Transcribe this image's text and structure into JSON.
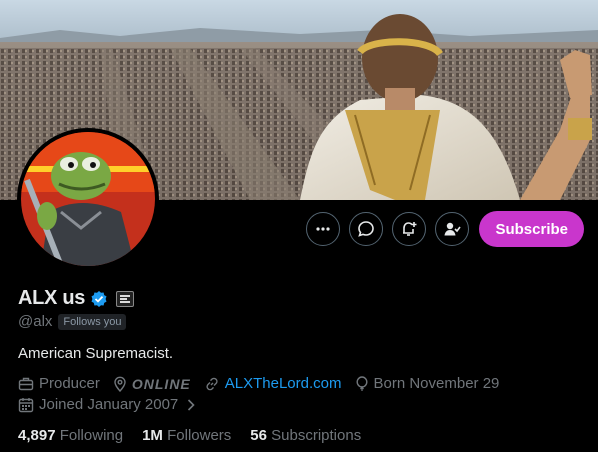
{
  "profile": {
    "display_name": "ALX us",
    "handle": "@alx",
    "follows_you": "Follows you",
    "bio": "American Supremacist.",
    "profession": "Producer",
    "location": "ONLINE",
    "website": "ALXTheLord.com",
    "birthday": "Born November 29",
    "joined": "Joined January 2007"
  },
  "stats": {
    "following_count": "4,897",
    "following_label": "Following",
    "followers_count": "1M",
    "followers_label": "Followers",
    "subscriptions_count": "56",
    "subscriptions_label": "Subscriptions"
  },
  "actions": {
    "subscribe_label": "Subscribe"
  },
  "icons": [
    "more-icon",
    "message-icon",
    "notify-icon",
    "following-icon",
    "verified-icon",
    "briefcase-icon",
    "location-icon",
    "link-icon",
    "balloon-icon",
    "calendar-icon",
    "chevron-right-icon"
  ],
  "colors": {
    "subscribe": "#c936cc",
    "link": "#1d9bf0",
    "verified": "#1d9bf0",
    "muted": "#71767b",
    "background": "#000000"
  }
}
